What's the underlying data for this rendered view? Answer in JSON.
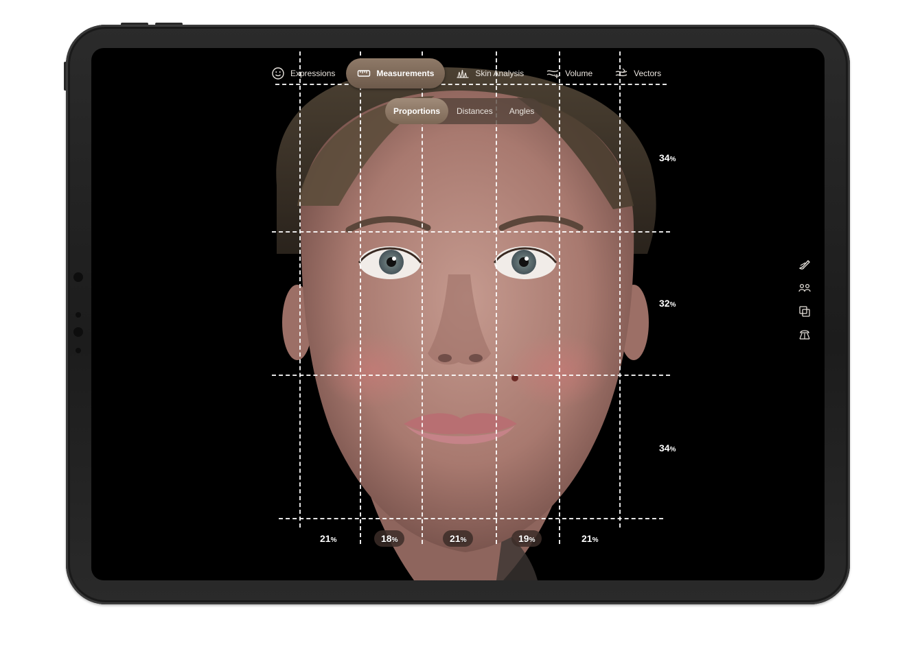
{
  "nav": {
    "tabs": [
      {
        "label": "Expressions",
        "icon": "smiley-icon"
      },
      {
        "label": "Measurements",
        "icon": "ruler-icon"
      },
      {
        "label": "Skin Analysis",
        "icon": "skin-analysis-icon"
      },
      {
        "label": "Volume",
        "icon": "volume-icon"
      },
      {
        "label": "Vectors",
        "icon": "vectors-icon"
      }
    ],
    "active_tab": "Measurements"
  },
  "subnav": {
    "tabs": [
      {
        "label": "Proportions"
      },
      {
        "label": "Distances"
      },
      {
        "label": "Angles"
      }
    ],
    "active_tab": "Proportions"
  },
  "proportions": {
    "vertical": [
      {
        "value": "34",
        "unit": "%"
      },
      {
        "value": "32",
        "unit": "%"
      },
      {
        "value": "34",
        "unit": "%"
      }
    ],
    "horizontal": [
      {
        "value": "21",
        "unit": "%"
      },
      {
        "value": "18",
        "unit": "%"
      },
      {
        "value": "21",
        "unit": "%"
      },
      {
        "value": "19",
        "unit": "%"
      },
      {
        "value": "21",
        "unit": "%"
      }
    ]
  },
  "tools": [
    {
      "icon": "brush-icon"
    },
    {
      "icon": "compare-people-icon"
    },
    {
      "icon": "copy-layers-icon"
    },
    {
      "icon": "spotlight-icon"
    }
  ],
  "colors": {
    "active_tab": "#7d6856",
    "screen_bg": "#000000",
    "grid_line": "#ffffff"
  }
}
